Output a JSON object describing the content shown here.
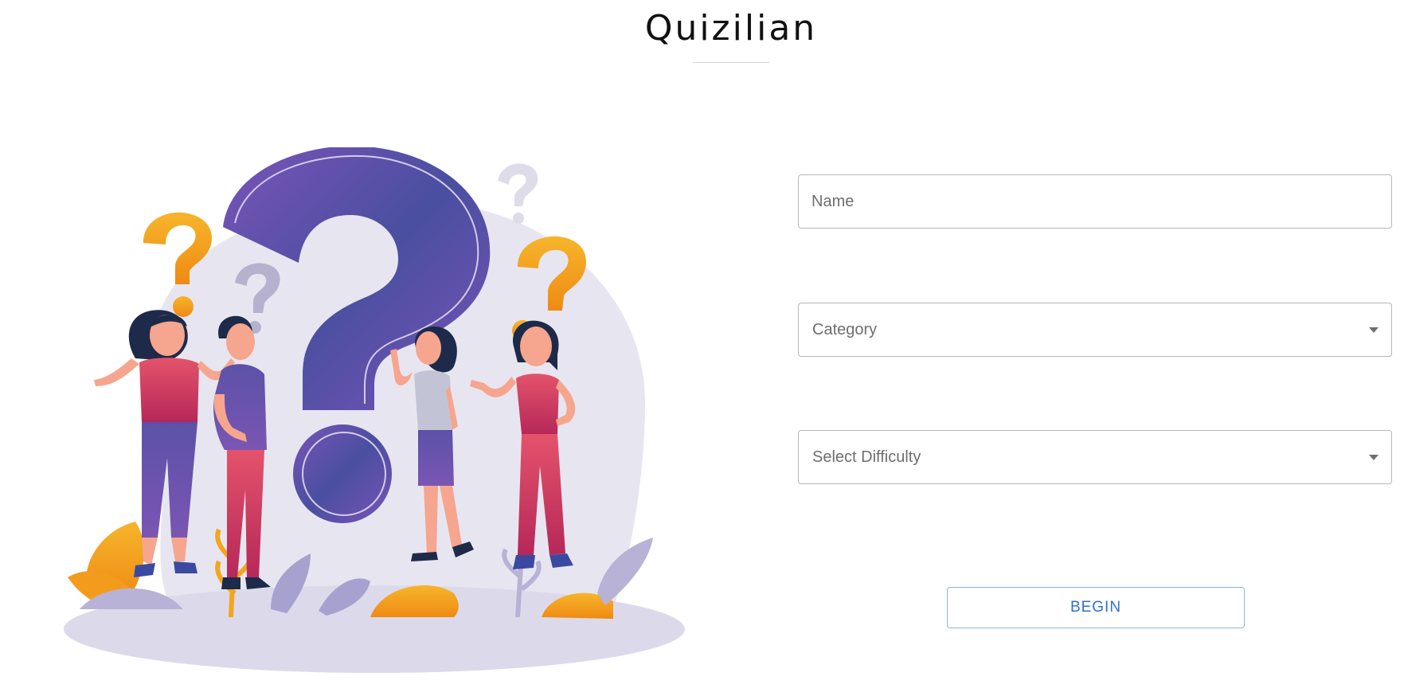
{
  "app": {
    "title": "Quizilian"
  },
  "form": {
    "name_placeholder": "Name",
    "name_value": "",
    "category_label": "Category",
    "difficulty_label": "Select Difficulty",
    "begin_label": "BEGIN"
  },
  "illustration": {
    "description_icon": "people-question-marks-illustration"
  },
  "colors": {
    "accent_blue": "#2f6fcf",
    "button_border": "#8db4e6",
    "purple": "#5b4aa6",
    "pink": "#d7405f",
    "orange": "#f3a51b"
  }
}
